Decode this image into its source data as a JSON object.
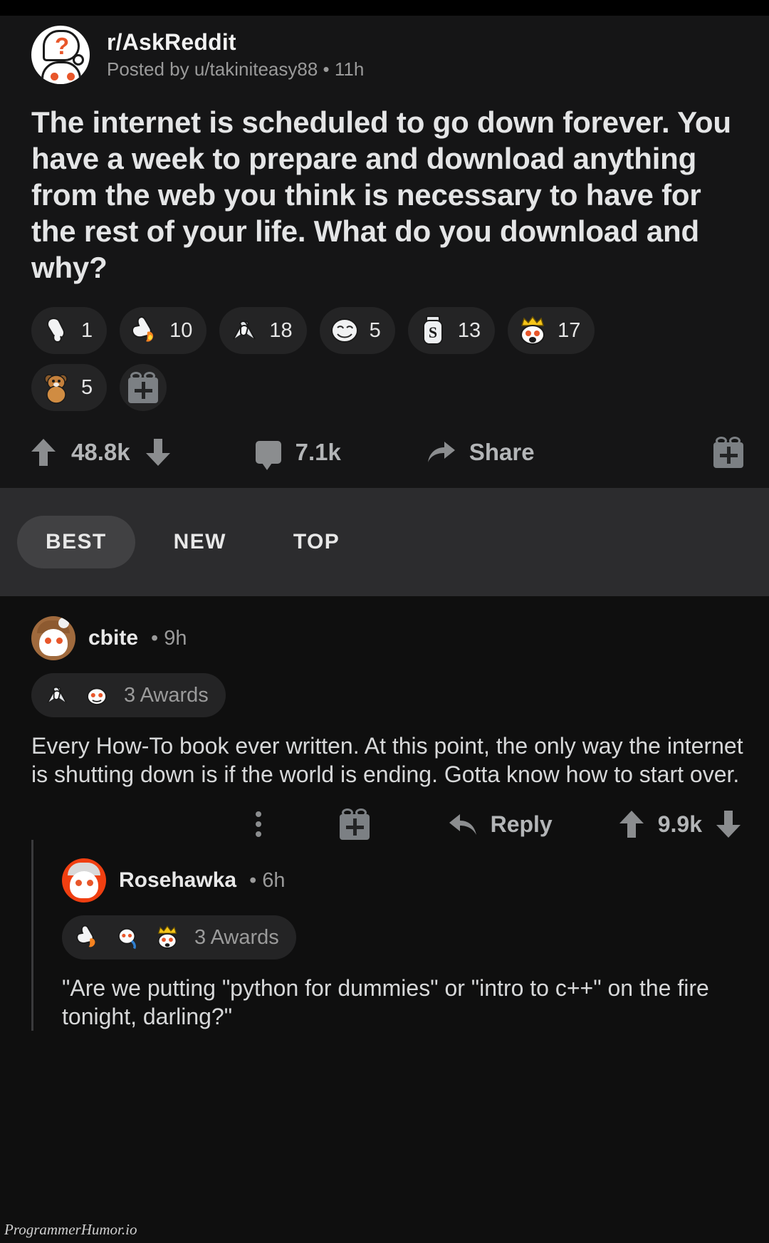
{
  "post": {
    "subreddit": "r/AskReddit",
    "posted_by": "Posted by u/takiniteasy88 • 11h",
    "title": "The internet is scheduled to go down forever. You have a week to prepare and download anything from the web you think is necessary to have for the rest of your life. What do you download and why?",
    "awards": [
      {
        "icon": "pointing-down-hand-award",
        "glyph": "👇",
        "count": "1"
      },
      {
        "icon": "thumbs-up-flame-award",
        "glyph": "👍",
        "count": "10"
      },
      {
        "icon": "handshake-award",
        "glyph": "🤝",
        "count": "18"
      },
      {
        "icon": "bread-face-award",
        "glyph": "😶",
        "count": "5"
      },
      {
        "icon": "silver-coin-award",
        "glyph": "🥈",
        "count": "13"
      },
      {
        "icon": "crown-snoo-award",
        "glyph": "👑",
        "count": "17"
      },
      {
        "icon": "bear-hug-award",
        "glyph": "🧸",
        "count": "5"
      }
    ],
    "give_award_label": "",
    "score": "48.8k",
    "comment_count": "7.1k",
    "share_label": "Share"
  },
  "sort": {
    "tabs": [
      {
        "label": "BEST",
        "active": true
      },
      {
        "label": "NEW",
        "active": false
      },
      {
        "label": "TOP",
        "active": false
      }
    ]
  },
  "comments": [
    {
      "author": "cbite",
      "time": "• 9h",
      "awards_icons": [
        "handshake-award",
        "snoo-award"
      ],
      "awards_label": "3 Awards",
      "body": "Every How-To book ever written. At this point, the only way the internet is shutting down is if the world is ending. Gotta know how to start over.",
      "reply_label": "Reply",
      "score": "9.9k"
    },
    {
      "author": "Rosehawka",
      "time": "• 6h",
      "awards_icons": [
        "thumbs-up-flame-award",
        "dive-snoo-award",
        "crown-snoo-award"
      ],
      "awards_label": "3 Awards",
      "body": "\"Are we putting \"python for dummies\" or \"intro to c++\" on the fire tonight, darling?\""
    }
  ],
  "watermark": "ProgrammerHumor.io",
  "colors": {
    "background": "#0f0f0f",
    "post_background": "#151516",
    "sort_background": "#2c2c2e",
    "accent_orange": "#e8562a",
    "text_primary": "#e4e5e6",
    "text_muted": "#9a9a9a"
  }
}
